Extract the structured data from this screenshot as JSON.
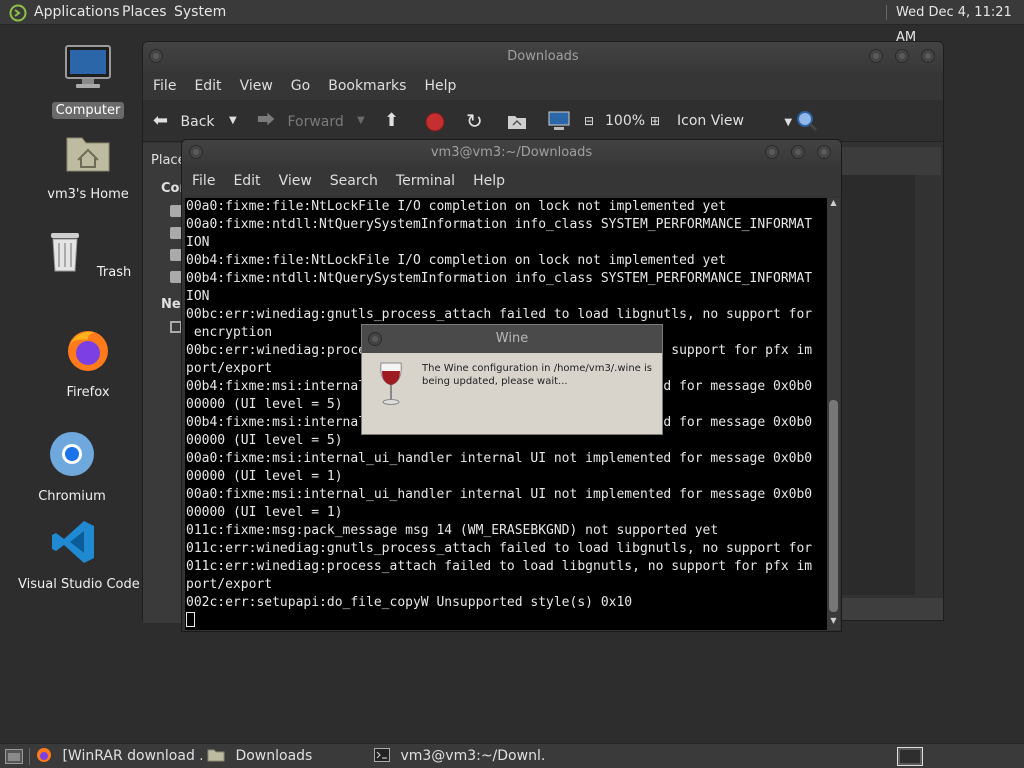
{
  "top_panel": {
    "menus": [
      "Applications",
      "Places",
      "System"
    ],
    "clock": "Wed Dec  4, 11:21 AM"
  },
  "desktop": {
    "icons": [
      {
        "label": "Computer",
        "icon": "computer-icon"
      },
      {
        "label": "vm3's Home",
        "icon": "home-folder-icon"
      },
      {
        "label": "Trash",
        "icon": "trash-icon"
      },
      {
        "label": "Firefox",
        "icon": "firefox-icon"
      },
      {
        "label": "Chromium",
        "icon": "chromium-icon"
      },
      {
        "label": "Visual Studio Code",
        "icon": "vscode-icon"
      }
    ]
  },
  "file_manager": {
    "title": "Downloads",
    "menu": [
      "File",
      "Edit",
      "View",
      "Go",
      "Bookmarks",
      "Help"
    ],
    "toolbar": {
      "back": "Back",
      "forward": "Forward",
      "zoom": "100%",
      "view_mode": "Icon View"
    },
    "sidebar": {
      "places_label": "Place",
      "computer_label": "Com",
      "network_label": "Net"
    }
  },
  "terminal": {
    "title": "vm3@vm3:~/Downloads",
    "menu": [
      "File",
      "Edit",
      "View",
      "Search",
      "Terminal",
      "Help"
    ],
    "lines": [
      "00a0:fixme:file:NtLockFile I/O completion on lock not implemented yet",
      "00a0:fixme:ntdll:NtQuerySystemInformation info_class SYSTEM_PERFORMANCE_INFORMAT",
      "ION",
      "00b4:fixme:file:NtLockFile I/O completion on lock not implemented yet",
      "00b4:fixme:ntdll:NtQuerySystemInformation info_class SYSTEM_PERFORMANCE_INFORMAT",
      "ION",
      "00bc:err:winediag:gnutls_process_attach failed to load libgnutls, no support for",
      " encryption",
      "00bc:err:winediag:process_attach failed to load libgnutls, no support for pfx im",
      "port/export",
      "00b4:fixme:msi:internal_ui_handler internal UI not implemented for message 0x0b0",
      "00000 (UI level = 5)",
      "00b4:fixme:msi:internal_ui_handler internal UI not implemented for message 0x0b0",
      "00000 (UI level = 5)",
      "00a0:fixme:msi:internal_ui_handler internal UI not implemented for message 0x0b0",
      "00000 (UI level = 1)",
      "00a0:fixme:msi:internal_ui_handler internal UI not implemented for message 0x0b0",
      "00000 (UI level = 1)",
      "011c:fixme:msg:pack_message msg 14 (WM_ERASEBKGND) not supported yet",
      "011c:err:winediag:gnutls_process_attach failed to load libgnutls, no support for",
      "011c:err:winediag:process_attach failed to load libgnutls, no support for pfx im",
      "port/export",
      "002c:err:setupapi:do_file_copyW Unsupported style(s) 0x10"
    ]
  },
  "wine_dialog": {
    "title": "Wine",
    "message": "The Wine configuration in /home/vm3/.wine is being updated, please wait..."
  },
  "taskbar": {
    "tasks": [
      {
        "label": "[WinRAR download ...",
        "icon": "firefox-icon"
      },
      {
        "label": "Downloads",
        "icon": "folder-icon"
      },
      {
        "label": "vm3@vm3:~/Downl...",
        "icon": "terminal-icon"
      }
    ]
  }
}
